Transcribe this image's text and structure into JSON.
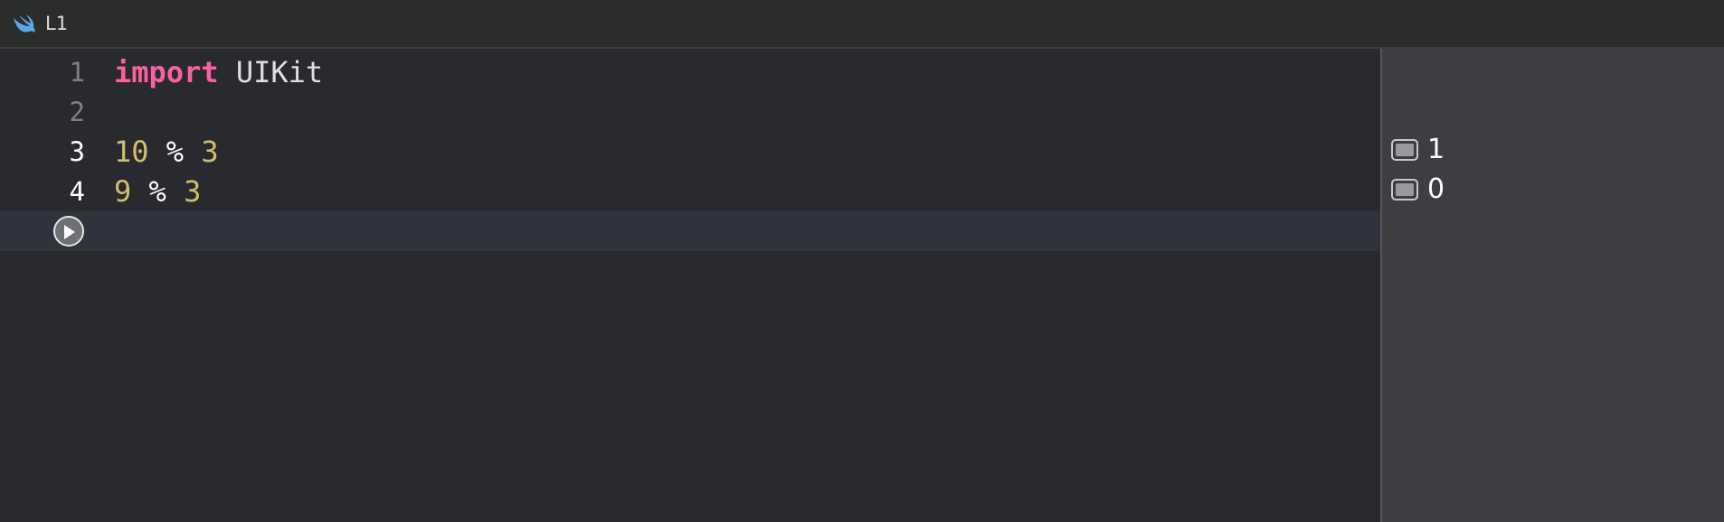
{
  "tab": {
    "icon": "swift-icon",
    "title": "L1"
  },
  "editor": {
    "lines": [
      {
        "number": "1",
        "tokens": [
          {
            "text": "import",
            "kind": "keyword"
          },
          {
            "text": " "
          },
          {
            "text": "UIKit",
            "kind": "identifier"
          }
        ]
      },
      {
        "number": "2",
        "tokens": []
      },
      {
        "number": "3",
        "tokens": [
          {
            "text": "10",
            "kind": "number"
          },
          {
            "text": " "
          },
          {
            "text": "%",
            "kind": "operator"
          },
          {
            "text": " "
          },
          {
            "text": "3",
            "kind": "number"
          }
        ]
      },
      {
        "number": "4",
        "tokens": [
          {
            "text": "9",
            "kind": "number"
          },
          {
            "text": " "
          },
          {
            "text": "%",
            "kind": "operator"
          },
          {
            "text": " "
          },
          {
            "text": "3",
            "kind": "number"
          }
        ]
      }
    ],
    "run_icon": "play-icon"
  },
  "results": [
    {
      "line": "3",
      "value": "1",
      "icon": "quick-look-icon"
    },
    {
      "line": "4",
      "value": "0",
      "icon": "quick-look-icon"
    }
  ],
  "colors": {
    "keyword": "#fc5fa3",
    "number": "#d0bf69",
    "text": "#dfdfe0",
    "editor_bg": "#292a30",
    "results_bg": "#3e3e42"
  }
}
